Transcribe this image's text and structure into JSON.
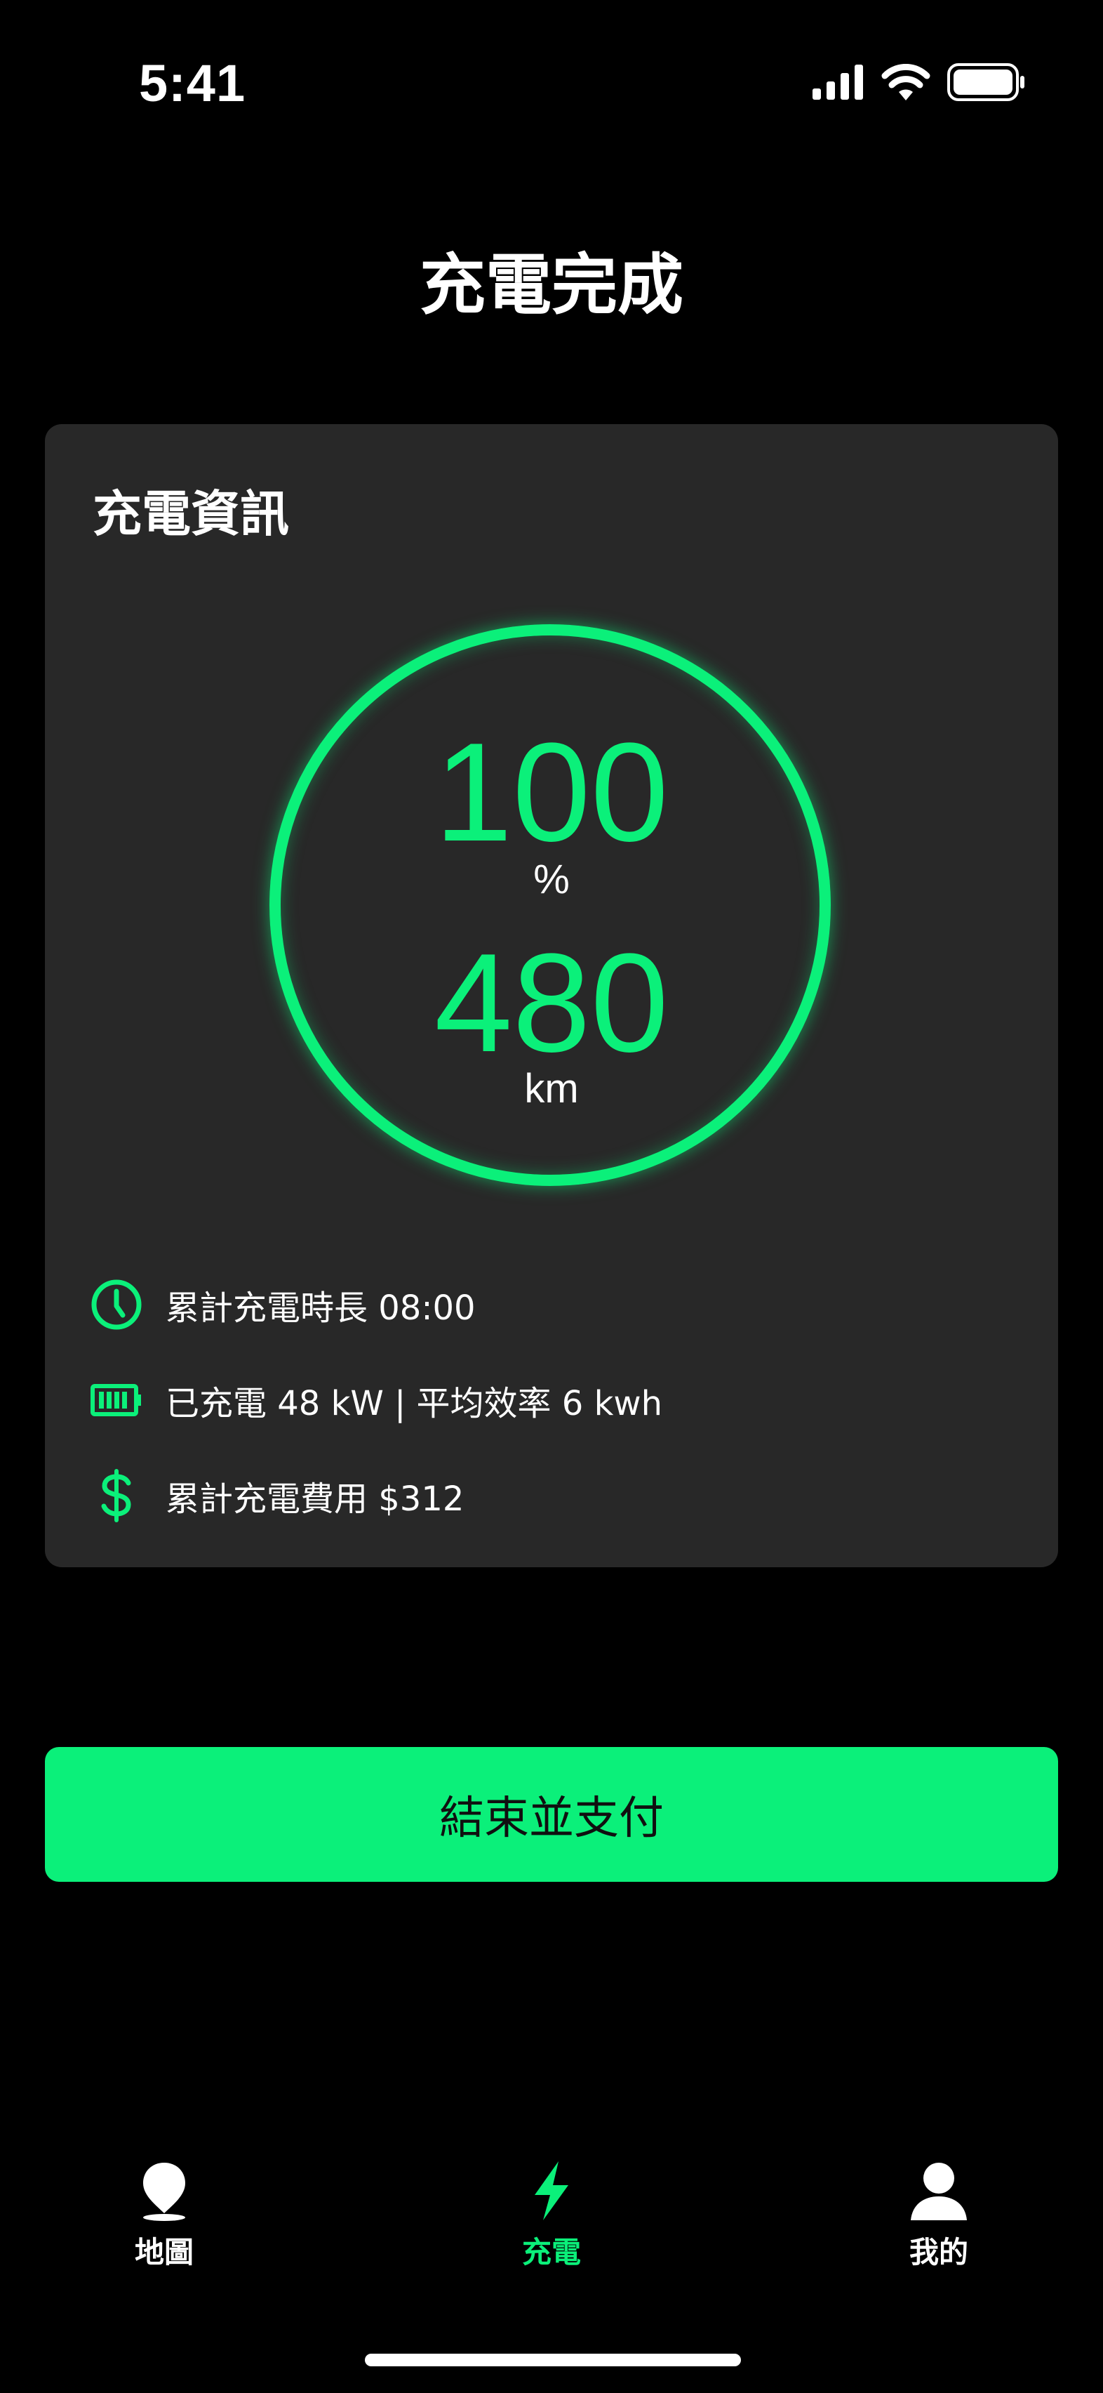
{
  "status_bar": {
    "time": "5:41"
  },
  "page": {
    "title": "充電完成"
  },
  "card": {
    "title": "充電資訊",
    "battery_percent": "100",
    "percent_unit": "%",
    "range": "480",
    "range_unit": "km",
    "info": [
      {
        "icon": "clock-icon",
        "text": "累計充電時長 08:00"
      },
      {
        "icon": "battery-icon",
        "text": "已充電 48 kW | 平均效率 6 kwh"
      },
      {
        "icon": "dollar-icon",
        "text": "累計充電費用 $312"
      }
    ]
  },
  "cta": {
    "label": "結束並支付"
  },
  "tabs": [
    {
      "label": "地圖",
      "icon": "map-pin-icon",
      "active": false
    },
    {
      "label": "充電",
      "icon": "lightning-icon",
      "active": true
    },
    {
      "label": "我的",
      "icon": "user-icon",
      "active": false
    }
  ],
  "colors": {
    "accent": "#0bf07a",
    "card": "#282828",
    "background": "#000000"
  }
}
